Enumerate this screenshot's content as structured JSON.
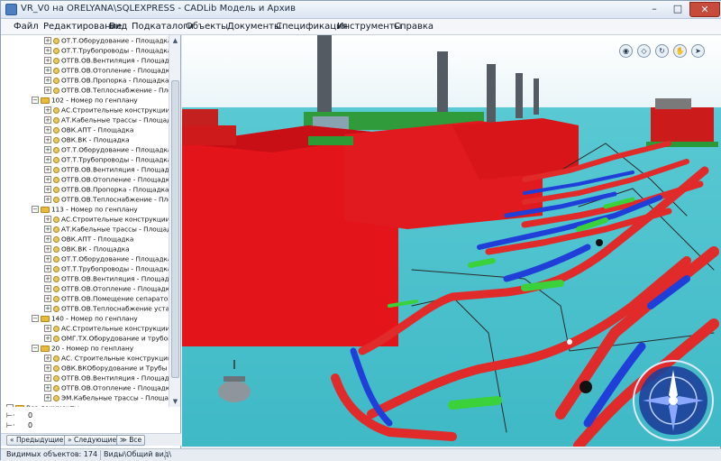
{
  "window": {
    "title": "VR_V0 на ORELYANA\\SQLEXPRESS - CADLib Модель и Архив",
    "min_glyph": "–",
    "max_glyph": "□",
    "close_glyph": "✕"
  },
  "menu": [
    "Файл",
    "Редактирование",
    "Вид",
    "Подкаталоги",
    "Объекты",
    "Документы",
    "Спецификация",
    "Инструменты",
    "Справка"
  ],
  "tree": [
    {
      "level": 2,
      "kind": "leaf",
      "label": "ОТ.Т.Оборудование - Площадка"
    },
    {
      "level": 2,
      "kind": "leaf",
      "label": "ОТ.Т.Трубопроводы - Площадка"
    },
    {
      "level": 2,
      "kind": "leaf",
      "label": "ОТГВ.ОВ.Вентиляция - Площадк"
    },
    {
      "level": 2,
      "kind": "leaf",
      "label": "ОТГВ.ОВ.Отопление - Площадка"
    },
    {
      "level": 2,
      "kind": "leaf",
      "label": "ОТГВ.ОВ.Пропорка - Площадка"
    },
    {
      "level": 2,
      "kind": "leaf",
      "label": "ОТГВ.ОВ.Теплоснабжение - Пло"
    },
    {
      "level": 1,
      "kind": "group",
      "label": "102 - Номер по генплану"
    },
    {
      "level": 2,
      "kind": "leaf",
      "label": "АС.Строительные конструкции -"
    },
    {
      "level": 2,
      "kind": "leaf",
      "label": "АТ.Кабельные трассы - Площадк"
    },
    {
      "level": 2,
      "kind": "leaf",
      "label": "ОВК.АПТ - Площадка"
    },
    {
      "level": 2,
      "kind": "leaf",
      "label": "ОВК.ВК - Площадка"
    },
    {
      "level": 2,
      "kind": "leaf",
      "label": "ОТ.Т.Оборудование - Площадка"
    },
    {
      "level": 2,
      "kind": "leaf",
      "label": "ОТ.Т.Трубопроводы - Площадка"
    },
    {
      "level": 2,
      "kind": "leaf",
      "label": "ОТГВ.ОВ.Вентиляция - Площадк"
    },
    {
      "level": 2,
      "kind": "leaf",
      "label": "ОТГВ.ОВ.Отопление - Площадка"
    },
    {
      "level": 2,
      "kind": "leaf",
      "label": "ОТГВ.ОВ.Пропорка - Площадка"
    },
    {
      "level": 2,
      "kind": "leaf",
      "label": "ОТГВ.ОВ.Теплоснабжение - Пло"
    },
    {
      "level": 1,
      "kind": "group",
      "label": "113 - Номер по генплану"
    },
    {
      "level": 2,
      "kind": "leaf",
      "label": "АС.Строительные конструкции -"
    },
    {
      "level": 2,
      "kind": "leaf",
      "label": "АТ.Кабельные трассы - Площадк"
    },
    {
      "level": 2,
      "kind": "leaf",
      "label": "ОВК.АПТ - Площадка"
    },
    {
      "level": 2,
      "kind": "leaf",
      "label": "ОВК.ВК - Площадка"
    },
    {
      "level": 2,
      "kind": "leaf",
      "label": "ОТ.Т.Оборудование - Площадка"
    },
    {
      "level": 2,
      "kind": "leaf",
      "label": "ОТ.Т.Трубопроводы - Площадка"
    },
    {
      "level": 2,
      "kind": "leaf",
      "label": "ОТГВ.ОВ.Вентиляция - Площадк"
    },
    {
      "level": 2,
      "kind": "leaf",
      "label": "ОТГВ.ОВ.Отопление - Площадка"
    },
    {
      "level": 2,
      "kind": "leaf",
      "label": "ОТГВ.ОВ.Помещение сепаратор"
    },
    {
      "level": 2,
      "kind": "leaf",
      "label": "ОТГВ.ОВ.Теплоснабжение устан"
    },
    {
      "level": 1,
      "kind": "group",
      "label": "140 - Номер по генплану"
    },
    {
      "level": 2,
      "kind": "leaf",
      "label": "АС.Строительные конструкции -"
    },
    {
      "level": 2,
      "kind": "leaf",
      "label": "ОМГ.ТХ.Оборудование и трубопр"
    },
    {
      "level": 1,
      "kind": "group",
      "label": "20 - Номер по генплану"
    },
    {
      "level": 2,
      "kind": "leaf",
      "label": "АС. Строительные конструкции -"
    },
    {
      "level": 2,
      "kind": "leaf",
      "label": "ОВК.ВКОборудование и Трубы -"
    },
    {
      "level": 2,
      "kind": "leaf",
      "label": "ОТГВ.ОВ.Вентиляция - Площадк"
    },
    {
      "level": 2,
      "kind": "leaf",
      "label": "ОТГВ.ОВ.Отопление - Площадка"
    },
    {
      "level": 2,
      "kind": "leaf",
      "label": "ЭМ.Кабельные трассы - Площад"
    },
    {
      "level": 0,
      "kind": "root",
      "label": "Все документы"
    }
  ],
  "properties": [
    {
      "label": "⊢·",
      "value": "0"
    },
    {
      "label": "⊢·",
      "value": "0"
    }
  ],
  "nav": {
    "prev_label": "Предыдущие",
    "next_label": "Следующие",
    "all_label": "Все"
  },
  "status": {
    "visible_objects": "Видимых объектов: 174",
    "view_path": "Виды\\Общий вид\\"
  },
  "viewport_tools": [
    "eye-icon",
    "cube-icon",
    "rotate-icon",
    "hand-icon",
    "arrow-icon"
  ],
  "colors": {
    "ground": "#4fc4cf",
    "building": "#e4141b",
    "pipe_red": "#e12a2a",
    "pipe_blue": "#1f3fd8",
    "equipment_green": "#3bd13b",
    "chimney": "#555b63",
    "compass": "#1e3f9a"
  }
}
